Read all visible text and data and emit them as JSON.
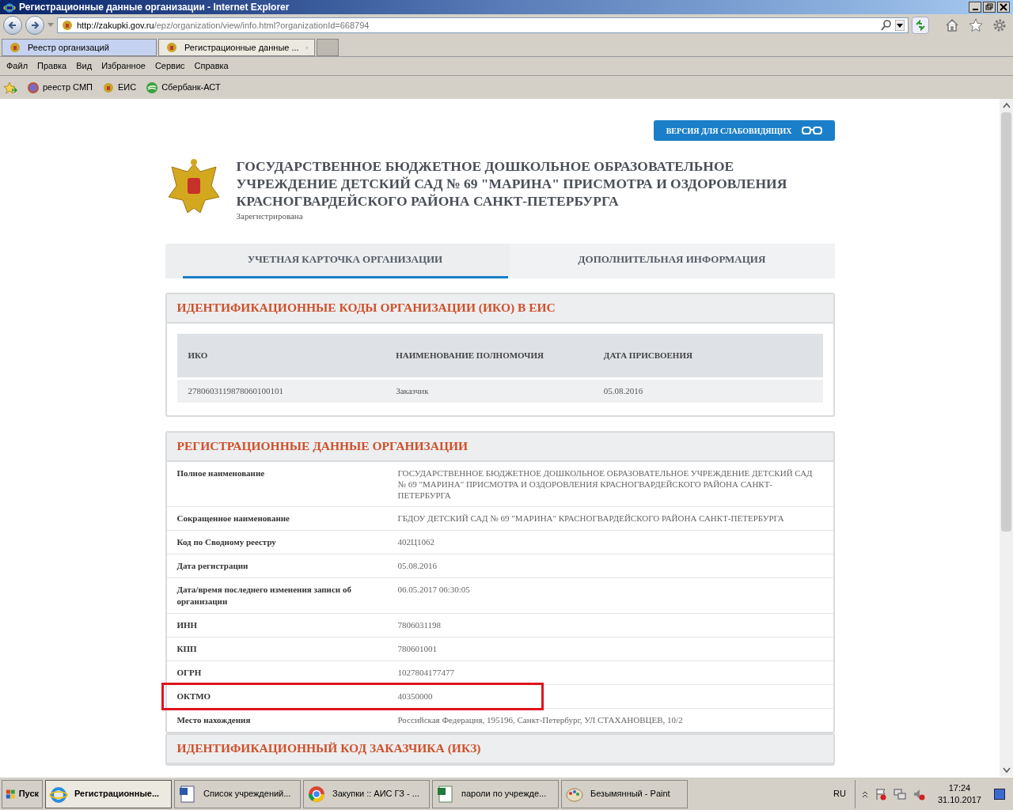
{
  "window": {
    "title": "Регистрационные данные организации - Internet Explorer"
  },
  "address_bar": {
    "url_host": "http://zakupki.gov.ru",
    "url_path": "/epz/organization/view/info.html?organizationId=668794"
  },
  "browser_tabs": [
    {
      "label": "Реестр организаций",
      "selected": false
    },
    {
      "label": "Регистрационные данные ...",
      "selected": true
    }
  ],
  "menu": [
    "Файл",
    "Правка",
    "Вид",
    "Избранное",
    "Сервис",
    "Справка"
  ],
  "favorites": [
    "реестр СМП",
    "ЕИС",
    "Сбербанк-АСТ"
  ],
  "page": {
    "accessibility_button": "ВЕРСИЯ ДЛЯ СЛАБОВИДЯЩИХ",
    "org_title": "ГОСУДАРСТВЕННОЕ БЮДЖЕТНОЕ ДОШКОЛЬНОЕ ОБРАЗОВАТЕЛЬНОЕ УЧРЕЖДЕНИЕ ДЕТСКИЙ САД № 69 \"МАРИНА\" ПРИСМОТРА И ОЗДОРОВЛЕНИЯ КРАСНОГВАРДЕЙСКОГО РАЙОНА САНКТ-ПЕТЕРБУРГА",
    "status": "Зарегистрирована",
    "tabs": [
      {
        "label": "УЧЕТНАЯ КАРТОЧКА ОРГАНИЗАЦИИ",
        "selected": true
      },
      {
        "label": "ДОПОЛНИТЕЛЬНАЯ ИНФОРМАЦИЯ",
        "selected": false
      }
    ],
    "iko_section": {
      "title": "ИДЕНТИФИКАЦИОННЫЕ КОДЫ ОРГАНИЗАЦИИ (ИКО) В ЕИС",
      "columns": [
        "ИКО",
        "НАИМЕНОВАНИЕ ПОЛНОМОЧИЯ",
        "ДАТА ПРИСВОЕНИЯ"
      ],
      "rows": [
        [
          "2780603119878060100101",
          "Заказчик",
          "05.08.2016"
        ]
      ]
    },
    "reg_section": {
      "title": "РЕГИСТРАЦИОННЫЕ ДАННЫЕ ОРГАНИЗАЦИИ",
      "rows": [
        {
          "label": "Полное наименование",
          "value": "ГОСУДАРСТВЕННОЕ БЮДЖЕТНОЕ ДОШКОЛЬНОЕ ОБРАЗОВАТЕЛЬНОЕ УЧРЕЖДЕНИЕ ДЕТСКИЙ САД № 69 \"МАРИНА\" ПРИСМОТРА И ОЗДОРОВЛЕНИЯ КРАСНОГВАРДЕЙСКОГО РАЙОНА САНКТ-ПЕТЕРБУРГА",
          "highlighted": false
        },
        {
          "label": "Сокращенное наименование",
          "value": "ГБДОУ ДЕТСКИЙ САД № 69 \"МАРИНА\" КРАСНОГВАРДЕЙСКОГО РАЙОНА САНКТ-ПЕТЕРБУРГА",
          "highlighted": false
        },
        {
          "label": "Код по Сводному реестру",
          "value": "402Ц1062",
          "highlighted": false
        },
        {
          "label": "Дата регистрации",
          "value": "05.08.2016",
          "highlighted": false
        },
        {
          "label": "Дата/время последнего изменения записи об организации",
          "value": "06.05.2017 06:30:05",
          "highlighted": false
        },
        {
          "label": "ИНН",
          "value": "7806031198",
          "highlighted": false
        },
        {
          "label": "КПП",
          "value": "780601001",
          "highlighted": false
        },
        {
          "label": "ОГРН",
          "value": "1027804177477",
          "highlighted": false
        },
        {
          "label": "ОКТМО",
          "value": "40350000",
          "highlighted": true
        },
        {
          "label": "Место нахождения",
          "value": "Российская Федерация, 195196, Санкт-Петербург, УЛ СТАХАНОВЦЕВ, 10/2",
          "highlighted": false
        }
      ]
    },
    "next_section": {
      "title": "ИДЕНТИФИКАЦИОННЫЙ КОД ЗАКАЗЧИКА (ИКЗ)"
    }
  },
  "taskbar": {
    "start": "Пуск",
    "items": [
      {
        "label": "Регистрационные...",
        "selected": true
      },
      {
        "label": "Список учреждений...",
        "selected": false
      },
      {
        "label": "Закупки :: АИС ГЗ - ...",
        "selected": false
      },
      {
        "label": "пароли по учрежде...",
        "selected": false
      },
      {
        "label": "Безымянный - Paint",
        "selected": false
      }
    ],
    "language": "RU",
    "time": "17:24",
    "date": "31.10.2017"
  }
}
